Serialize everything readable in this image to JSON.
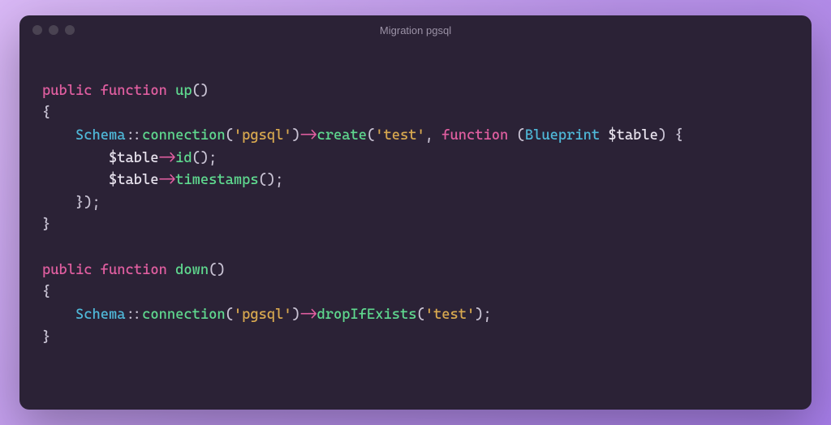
{
  "window": {
    "title": "Migration pgsql"
  },
  "code": {
    "up_signature": {
      "vis": "public",
      "kw": "function",
      "name": "up",
      "parens": "()"
    },
    "down_signature": {
      "vis": "public",
      "kw": "function",
      "name": "down",
      "parens": "()"
    },
    "brace_open": "{",
    "brace_close": "}",
    "closure_close": "});",
    "up_body": {
      "schema": "Schema",
      "dcolon": "::",
      "conn": "connection",
      "p_open": "(",
      "conn_arg": "'pgsql'",
      "p_close": ")",
      "arrow": "->",
      "create": "create",
      "create_arg1": "'test'",
      "comma": ", ",
      "function_kw": "function",
      "space": " ",
      "cls_open": "(",
      "blueprint": "Blueprint",
      "table_param": "$table",
      "cls_close": ")",
      "body_open": " {",
      "id_call": "id",
      "ts_call": "timestamps",
      "empty_parens": "()",
      "semi": ";",
      "table_var": "$table"
    },
    "down_body": {
      "schema": "Schema",
      "dcolon": "::",
      "conn": "connection",
      "p_open": "(",
      "conn_arg": "'pgsql'",
      "p_close": ")",
      "arrow": "->",
      "drop": "dropIfExists",
      "drop_arg": "'test'",
      "semi": ";"
    }
  }
}
